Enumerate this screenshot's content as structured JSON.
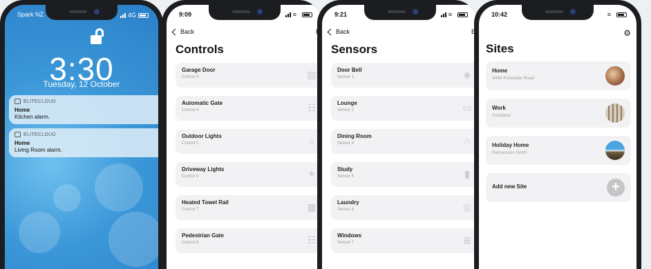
{
  "lock_screen": {
    "carrier": "Spark NZ",
    "network": "4G",
    "time": "3:30",
    "date": "Tuesday, 12 October",
    "notifications": [
      {
        "app": "ELITECLOUD",
        "title": "Home",
        "body": "Kitchen alarm."
      },
      {
        "app": "ELITECLOUD",
        "title": "Home",
        "body": "Living Room alarm."
      }
    ]
  },
  "controls_screen": {
    "time": "9:09",
    "back": "Back",
    "edit": "Ed",
    "title": "Controls",
    "items": [
      {
        "name": "Garage Door",
        "sub": "Control 3",
        "icon": "garage-icon"
      },
      {
        "name": "Automatic Gate",
        "sub": "Control 4",
        "icon": "gate-icon"
      },
      {
        "name": "Outdoor Lights",
        "sub": "Control 5",
        "icon": "light-icon"
      },
      {
        "name": "Driveway Lights",
        "sub": "Control 6",
        "icon": "lamp-icon"
      },
      {
        "name": "Heated Towel Rail",
        "sub": "Control 7",
        "icon": "towel-rail-icon"
      },
      {
        "name": "Pedestrian Gate",
        "sub": "Control 8",
        "icon": "gate-icon"
      }
    ]
  },
  "sensors_screen": {
    "time": "9:21",
    "back": "Back",
    "edit": "Ed",
    "title": "Sensors",
    "items": [
      {
        "name": "Door Bell",
        "sub": "Sensor 1",
        "icon": "bell-icon"
      },
      {
        "name": "Lounge",
        "sub": "Sensor 2",
        "icon": "sofa-icon"
      },
      {
        "name": "Dining Room",
        "sub": "Sensor 4",
        "icon": "dining-icon"
      },
      {
        "name": "Study",
        "sub": "Sensor 5",
        "icon": "books-icon"
      },
      {
        "name": "Laundry",
        "sub": "Sensor 6",
        "icon": "washer-icon"
      },
      {
        "name": "Windows",
        "sub": "Sensor 7",
        "icon": "window-icon"
      }
    ]
  },
  "sites_screen": {
    "time": "10:42",
    "title": "Sites",
    "items": [
      {
        "name": "Home",
        "sub": "3448 Rosedale Road"
      },
      {
        "name": "Work",
        "sub": "Auckland"
      },
      {
        "name": "Holiday Home",
        "sub": "Palmerston North"
      }
    ],
    "add_label": "Add new Site"
  }
}
